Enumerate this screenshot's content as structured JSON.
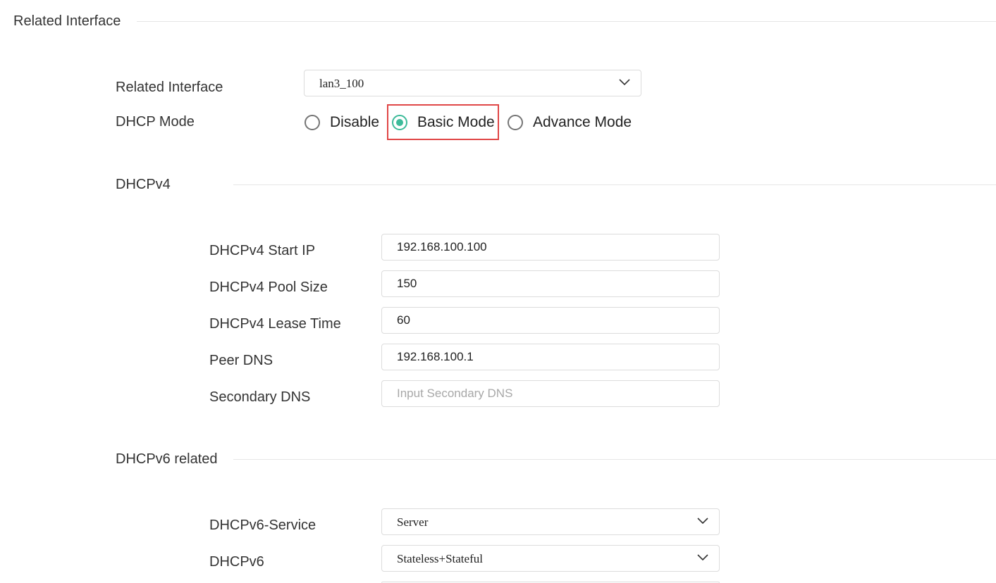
{
  "related_interface_section": {
    "title": "Related Interface",
    "related_interface": {
      "label": "Related Interface",
      "value": "lan3_100"
    },
    "dhcp_mode": {
      "label": "DHCP Mode",
      "options": [
        "Disable",
        "Basic Mode",
        "Advance Mode"
      ],
      "selected": "Basic Mode"
    }
  },
  "dhcpv4": {
    "title": "DHCPv4",
    "start_ip": {
      "label": "DHCPv4 Start IP",
      "value": "192.168.100.100"
    },
    "pool_size": {
      "label": "DHCPv4 Pool Size",
      "value": "150"
    },
    "lease_time": {
      "label": "DHCPv4 Lease Time",
      "value": "60"
    },
    "peer_dns": {
      "label": "Peer DNS",
      "value": "192.168.100.1"
    },
    "secondary_dns": {
      "label": "Secondary DNS",
      "value": "",
      "placeholder": "Input Secondary DNS"
    }
  },
  "dhcpv6": {
    "title": "DHCPv6 related",
    "service": {
      "label": "DHCPv6-Service",
      "value": "Server"
    },
    "mode": {
      "label": "DHCPv6",
      "value": "Stateless+Stateful"
    }
  },
  "icons": {
    "dropdown": "chevron-down-icon"
  },
  "colors": {
    "accent": "#3dbb9a",
    "highlight": "#e04646",
    "border": "#dcdcdc",
    "divider": "#e6e6e6"
  }
}
